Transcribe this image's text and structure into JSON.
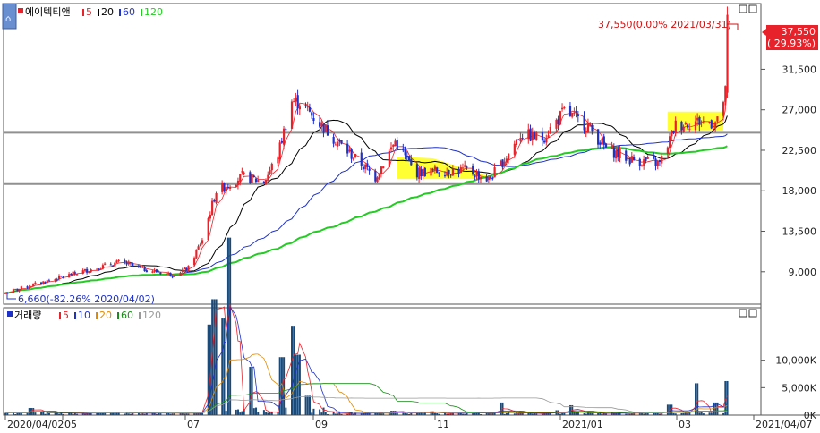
{
  "app": {
    "corner_icon": "home-icon"
  },
  "legend_price": {
    "name": "에이텍티앤",
    "ma": [
      {
        "label": "5",
        "color": "#e8222a"
      },
      {
        "label": "20",
        "color": "#000000"
      },
      {
        "label": "60",
        "color": "#1f32c8"
      },
      {
        "label": "120",
        "color": "#22cc22"
      }
    ]
  },
  "legend_volume": {
    "name": "거래량",
    "ma": [
      {
        "label": "5",
        "color": "#e8222a"
      },
      {
        "label": "10",
        "color": "#1f32c8"
      },
      {
        "label": "20",
        "color": "#e08a00"
      },
      {
        "label": "60",
        "color": "#1a8c1a"
      },
      {
        "label": "120",
        "color": "#999999"
      }
    ]
  },
  "annotations": {
    "high": "37,550(0.00% 2021/03/31)",
    "low": "6,660(-82.26% 2020/04/02)",
    "last_price": "37,550",
    "last_change": "( 29.93%)"
  },
  "colors": {
    "up": "#e8222a",
    "down": "#1f32c8",
    "highlight": "#ffff33",
    "level_line": "#909090"
  },
  "chart_data": [
    {
      "type": "candlestick",
      "title": "에이텍티앤",
      "x_start": "2020/04/02",
      "x_end": "2021/04/07",
      "x_tick_labels": [
        "2020/04/02",
        "05",
        "07",
        "09",
        "11",
        "2021/01",
        "03",
        "2021/04/07"
      ],
      "y_ticks": [
        9000,
        13500,
        18000,
        22500,
        27000,
        31500
      ],
      "y_tick_labels": [
        "9,000",
        "13,500",
        "18,000",
        "22,500",
        "27,000",
        "31,500"
      ],
      "ylim": [
        5600,
        38600
      ],
      "horizontal_levels": [
        24500,
        18800
      ],
      "highlight_zones": [
        {
          "from": "2020/10/16",
          "to": "2020/11/30",
          "low": 19300,
          "high": 21800
        },
        {
          "from": "2021/03/01",
          "to": "2021/03/29",
          "low": 24700,
          "high": 26800
        }
      ],
      "highlight_zone_shape": [
        "rect",
        "parallelogram"
      ],
      "close_keypoints": [
        [
          "2020/04/02",
          6660
        ],
        [
          "2020/04/20",
          7800
        ],
        [
          "2020/05/10",
          9000
        ],
        [
          "2020/05/30",
          10100
        ],
        [
          "2020/06/10",
          9300
        ],
        [
          "2020/06/25",
          8700
        ],
        [
          "2020/07/03",
          9400
        ],
        [
          "2020/07/10",
          12600
        ],
        [
          "2020/07/17",
          18000
        ],
        [
          "2020/07/30",
          19600
        ],
        [
          "2020/08/10",
          19000
        ],
        [
          "2020/08/17",
          22000
        ],
        [
          "2020/08/24",
          28000
        ],
        [
          "2020/08/28",
          27800
        ],
        [
          "2020/09/07",
          25500
        ],
        [
          "2020/09/18",
          23000
        ],
        [
          "2020/10/05",
          19500
        ],
        [
          "2020/10/15",
          23500
        ],
        [
          "2020/10/25",
          20000
        ],
        [
          "2020/11/05",
          20200
        ],
        [
          "2020/11/20",
          20300
        ],
        [
          "2020/12/01",
          19200
        ],
        [
          "2020/12/10",
          21800
        ],
        [
          "2020/12/17",
          24300
        ],
        [
          "2020/12/28",
          23800
        ],
        [
          "2021/01/08",
          26800
        ],
        [
          "2021/01/20",
          25200
        ],
        [
          "2021/01/29",
          22700
        ],
        [
          "2021/02/10",
          21500
        ],
        [
          "2021/02/25",
          21000
        ],
        [
          "2021/03/05",
          25300
        ],
        [
          "2021/03/15",
          25700
        ],
        [
          "2021/03/26",
          25600
        ],
        [
          "2021/03/30",
          28900
        ],
        [
          "2021/03/31",
          37550
        ]
      ],
      "high": {
        "value": 37550,
        "date": "2021/03/31"
      },
      "low": {
        "value": 6660,
        "date": "2020/04/02"
      },
      "last": {
        "value": 37550,
        "change_pct": 29.93
      }
    },
    {
      "type": "bar",
      "title": "거래량",
      "y_ticks": [
        0,
        5000,
        10000
      ],
      "y_tick_labels": [
        "0K",
        "5,000K",
        "10,000K"
      ],
      "ylim": [
        0,
        15000
      ],
      "volume_spikes": [
        [
          "2020/04/15",
          1300
        ],
        [
          "2020/05/28",
          300
        ],
        [
          "2020/07/13",
          7500
        ],
        [
          "2020/07/16",
          9600
        ],
        [
          "2020/07/20",
          8000
        ],
        [
          "2020/07/24",
          14700
        ],
        [
          "2020/08/03",
          4000
        ],
        [
          "2020/08/19",
          4800
        ],
        [
          "2020/08/24",
          7400
        ],
        [
          "2020/08/27",
          5000
        ],
        [
          "2020/09/01",
          1600
        ],
        [
          "2020/10/14",
          800
        ],
        [
          "2020/11/02",
          700
        ],
        [
          "2020/12/07",
          2300
        ],
        [
          "2021/01/04",
          900
        ],
        [
          "2021/01/11",
          1800
        ],
        [
          "2021/03/02",
          1900
        ],
        [
          "2021/03/15",
          5800
        ],
        [
          "2021/03/25",
          2300
        ],
        [
          "2021/03/31",
          6200
        ]
      ],
      "base_level": 400
    }
  ]
}
